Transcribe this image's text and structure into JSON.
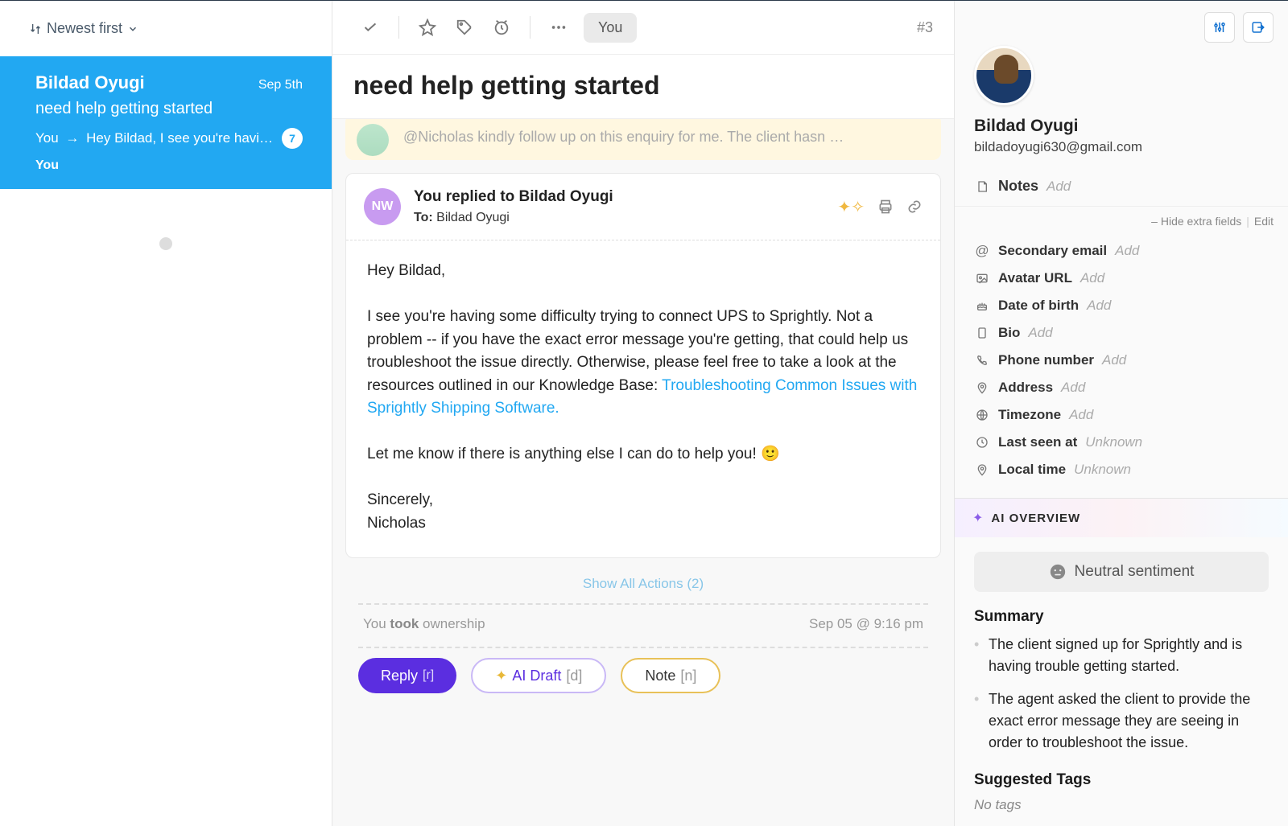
{
  "left": {
    "sort_label": "Newest first",
    "conversation": {
      "name": "Bildad Oyugi",
      "date": "Sep 5th",
      "subject": "need help getting started",
      "preview_prefix": "You",
      "preview_body": "Hey Bildad,   I see you're havi…",
      "badge": "7",
      "assignee": "You"
    }
  },
  "toolbar": {
    "you_pill": "You",
    "ticket_number": "#3"
  },
  "subject": "need help getting started",
  "prev_note": "@Nicholas kindly follow up on this enquiry for me. The client hasn …",
  "message": {
    "avatar_initials": "NW",
    "title": "You replied to Bildad Oyugi",
    "to_label": "To:",
    "to_name": "Bildad Oyugi",
    "greeting": "Hey Bildad,",
    "para1": "I see you're having some difficulty trying to connect UPS to Sprightly. Not a problem -- if you have the exact error message you're getting, that could help us troubleshoot the issue directly. Otherwise, please feel free to take a look at the resources outlined in our Knowledge Base:",
    "link_text": "Troubleshooting Common Issues with Sprightly Shipping Software.",
    "para2": "Let me know if there is anything else I can do to help you! 🙂",
    "signoff1": "Sincerely,",
    "signoff2": "Nicholas"
  },
  "show_actions": "Show All Actions (2)",
  "ownership": {
    "text_prefix": "You ",
    "text_bold": "took",
    "text_suffix": " ownership",
    "timestamp": "Sep 05 @ 9:16 pm"
  },
  "buttons": {
    "reply": "Reply",
    "reply_shortcut": "[r]",
    "ai_draft": "AI Draft",
    "ai_draft_shortcut": "[d]",
    "note": "Note",
    "note_shortcut": "[n]"
  },
  "profile": {
    "name": "Bildad Oyugi",
    "email": "bildadoyugi630@gmail.com",
    "notes_label": "Notes",
    "add_label": "Add",
    "hide_fields": "– Hide extra fields",
    "edit": "Edit",
    "fields": {
      "secondary_email": {
        "label": "Secondary email",
        "value": "Add"
      },
      "avatar_url": {
        "label": "Avatar URL",
        "value": "Add"
      },
      "dob": {
        "label": "Date of birth",
        "value": "Add"
      },
      "bio": {
        "label": "Bio",
        "value": "Add"
      },
      "phone": {
        "label": "Phone number",
        "value": "Add"
      },
      "address": {
        "label": "Address",
        "value": "Add"
      },
      "timezone": {
        "label": "Timezone",
        "value": "Add"
      },
      "last_seen": {
        "label": "Last seen at",
        "value": "Unknown"
      },
      "local_time": {
        "label": "Local time",
        "value": "Unknown"
      }
    }
  },
  "ai": {
    "overview_title": "AI OVERVIEW",
    "sentiment": "Neutral sentiment",
    "summary_heading": "Summary",
    "summary": [
      "The client signed up for Sprightly and is having trouble getting started.",
      "The agent asked the client to provide the exact error message they are seeing in order to troubleshoot the issue."
    ],
    "tags_heading": "Suggested Tags",
    "no_tags": "No tags"
  }
}
